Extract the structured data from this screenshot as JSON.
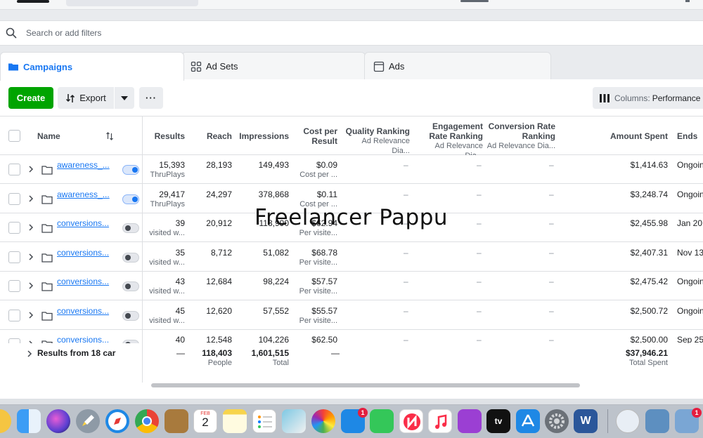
{
  "search": {
    "placeholder": "Search or add filters"
  },
  "tabs": [
    {
      "label": "Campaigns"
    },
    {
      "label": "Ad Sets"
    },
    {
      "label": "Ads"
    }
  ],
  "toolbar": {
    "create_label": "Create",
    "export_label": "Export",
    "more_label": "···",
    "columns_prefix": "Columns:",
    "columns_value": "Performance"
  },
  "columns": {
    "name": "Name",
    "results": "Results",
    "reach": "Reach",
    "impressions": "Impressions",
    "cost_per_result_1": "Cost per",
    "cost_per_result_2": "Result",
    "quality_ranking": "Quality Ranking",
    "quality_ranking_sub": "Ad Relevance Dia...",
    "engagement_ranking_1": "Engagement",
    "engagement_ranking_2": "Rate Ranking",
    "engagement_ranking_sub": "Ad Relevance Dia...",
    "conversion_ranking_1": "Conversion Rate",
    "conversion_ranking_2": "Ranking",
    "conversion_ranking_sub": "Ad Relevance Dia...",
    "amount_spent": "Amount Spent",
    "ends": "Ends"
  },
  "rows": [
    {
      "name": "awareness_...",
      "on": true,
      "results": "15,393",
      "results_sub": "ThruPlays",
      "reach": "28,193",
      "impressions": "149,493",
      "cpr": "$0.09",
      "cpr_sub": "Cost per ...",
      "quality": "–",
      "engagement": "–",
      "conversion": "–",
      "spent": "$1,414.63",
      "ends": "Ongoing"
    },
    {
      "name": "awareness_...",
      "on": true,
      "results": "29,417",
      "results_sub": "ThruPlays",
      "reach": "24,297",
      "impressions": "378,868",
      "cpr": "$0.11",
      "cpr_sub": "Cost per ...",
      "quality": "–",
      "engagement": "–",
      "conversion": "–",
      "spent": "$3,248.74",
      "ends": "Ongoing"
    },
    {
      "name": "conversions...",
      "on": false,
      "results": "39",
      "results_sub": "visited w...",
      "reach": "20,912",
      "impressions": "118,990",
      "cpr": "$62.94",
      "cpr_sub": "Per visite...",
      "quality": "–",
      "engagement": "–",
      "conversion": "–",
      "spent": "$2,455.98",
      "ends": "Jan 20"
    },
    {
      "name": "conversions...",
      "on": false,
      "results": "35",
      "results_sub": "visited w...",
      "reach": "8,712",
      "impressions": "51,082",
      "cpr": "$68.78",
      "cpr_sub": "Per visite...",
      "quality": "–",
      "engagement": "–",
      "conversion": "–",
      "spent": "$2,407.31",
      "ends": "Nov 13"
    },
    {
      "name": "conversions...",
      "on": false,
      "results": "43",
      "results_sub": "visited w...",
      "reach": "12,684",
      "impressions": "98,224",
      "cpr": "$57.57",
      "cpr_sub": "Per visite...",
      "quality": "–",
      "engagement": "–",
      "conversion": "–",
      "spent": "$2,475.42",
      "ends": "Ongoing"
    },
    {
      "name": "conversions...",
      "on": false,
      "results": "45",
      "results_sub": "visited w...",
      "reach": "12,620",
      "impressions": "57,552",
      "cpr": "$55.57",
      "cpr_sub": "Per visite...",
      "quality": "–",
      "engagement": "–",
      "conversion": "–",
      "spent": "$2,500.72",
      "ends": "Ongoing"
    },
    {
      "name": "conversions...",
      "on": false,
      "results": "40",
      "results_sub": "",
      "reach": "12,548",
      "impressions": "104,226",
      "cpr": "$62.50",
      "cpr_sub": "",
      "quality": "–",
      "engagement": "–",
      "conversion": "–",
      "spent": "$2,500.00",
      "ends": "Sep 25"
    }
  ],
  "totals": {
    "label": "Results from 18 car",
    "results": "—",
    "reach": "118,403",
    "reach_sub": "People",
    "impressions": "1,601,515",
    "impressions_sub": "Total",
    "cpr": "—",
    "spent": "$37,946.21",
    "spent_sub": "Total Spent"
  },
  "watermark": "Freelancer Pappu",
  "dock": {
    "calendar_month": "FEB",
    "calendar_day": "2",
    "badge_messages": "1",
    "badge_preview": "1",
    "appletv_label": "tv"
  },
  "colors": {
    "brand_blue": "#1877f2",
    "create_green": "#00a400"
  }
}
